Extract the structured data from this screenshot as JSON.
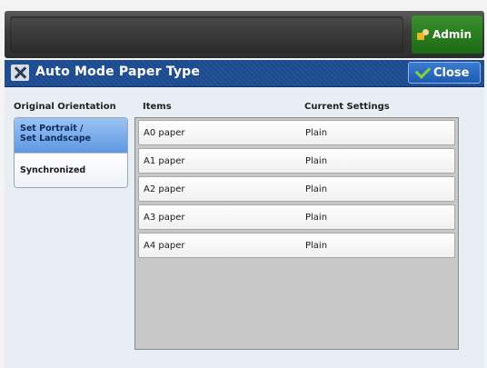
{
  "header": {
    "admin_label": "Admin"
  },
  "titlebar": {
    "title": "Auto Mode Paper Type",
    "close_label": "Close"
  },
  "columns": {
    "orientation": "Original Orientation",
    "items": "Items",
    "current_settings": "Current Settings"
  },
  "orientation_options": [
    {
      "label_line1": "Set Portrait /",
      "label_line2": "Set Landscape",
      "selected": true
    },
    {
      "label": "Synchronized",
      "selected": false
    }
  ],
  "rows": [
    {
      "item": "A0 paper",
      "setting": "Plain"
    },
    {
      "item": "A1 paper",
      "setting": "Plain"
    },
    {
      "item": "A2 paper",
      "setting": "Plain"
    },
    {
      "item": "A3 paper",
      "setting": "Plain"
    },
    {
      "item": "A4 paper",
      "setting": "Plain"
    }
  ],
  "colors": {
    "title_blue": "#1e4a8a",
    "admin_green": "#1d6a15",
    "selected_blue": "#5f97e2",
    "close_blue": "#1f5bb0"
  }
}
